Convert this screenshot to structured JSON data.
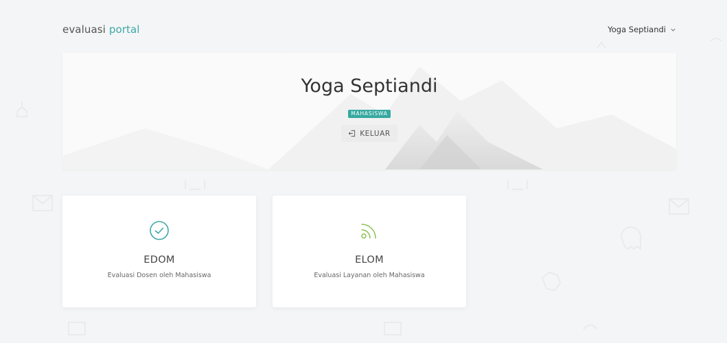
{
  "header": {
    "brand_main": "evaluasi",
    "brand_accent": "portal",
    "user_name": "Yoga Septiandi"
  },
  "hero": {
    "name": "Yoga Septiandi",
    "role_badge": "MAHASISWA",
    "logout_label": "KELUAR"
  },
  "cards": [
    {
      "title": "EDOM",
      "description": "Evaluasi Dosen oleh Mahasiswa",
      "icon": "check-circle-icon",
      "icon_color": "#3fa7a7"
    },
    {
      "title": "ELOM",
      "description": "Evaluasi Layanan oleh Mahasiswa",
      "icon": "rss-icon",
      "icon_color": "#8cc152"
    }
  ],
  "colors": {
    "accent": "#3fa7a7",
    "badge": "#36a9a0",
    "background": "#f3f5f6"
  }
}
